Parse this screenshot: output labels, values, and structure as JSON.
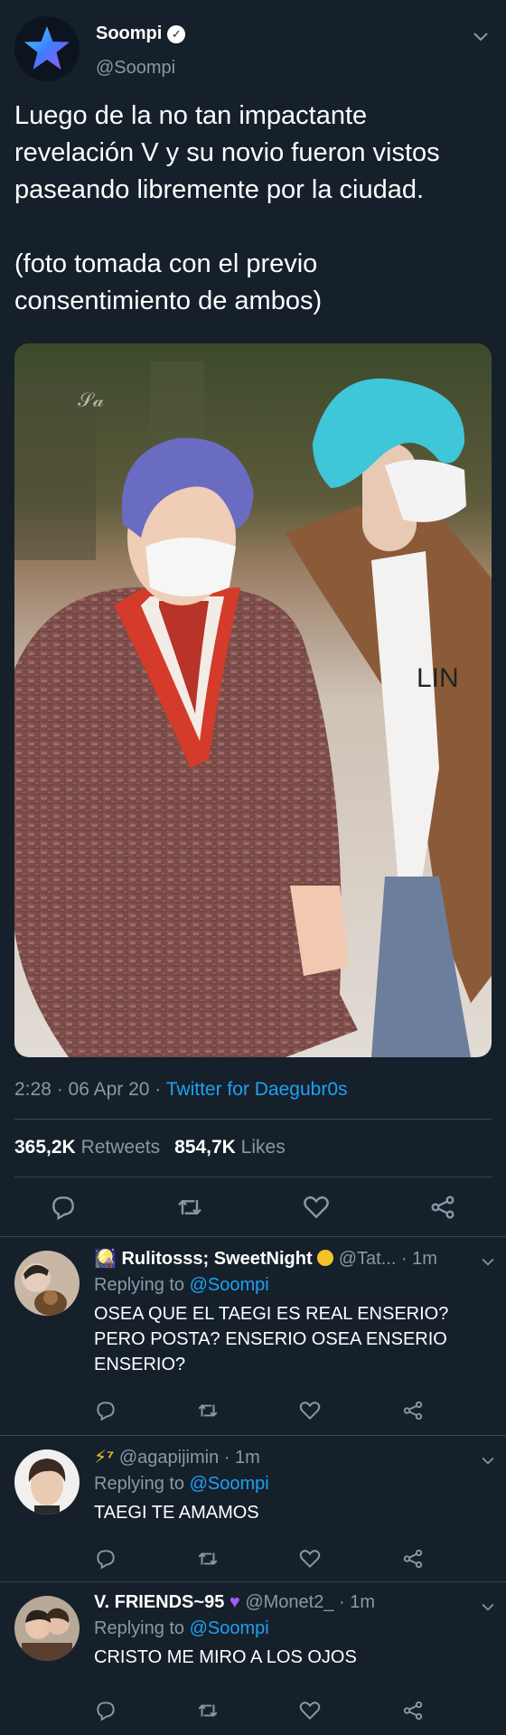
{
  "post": {
    "author_name": "Soompi",
    "handle": "@Soompi",
    "text_1": "Luego de la no tan impactante revelación V y su novio fueron vistos paseando libremente por la ciudad.",
    "text_2": "(foto tomada con el previo consentimiento de ambos)",
    "time": "2:28",
    "date": "06 Apr 20",
    "source": "Twitter for Daegubr0s",
    "retweets_count": "365,2K",
    "retweets_label": "Retweets",
    "likes_count": "854,7K",
    "likes_label": "Likes",
    "photo_shirt_text": "LIN"
  },
  "replies": [
    {
      "name": "Rulitosss; SweetNight",
      "handle": "@Tat...",
      "time": "1m",
      "replying_label": "Replying to",
      "mention": "@Soompi",
      "text": "OSEA QUE EL TAEGI ES REAL ENSERIO? PERO POSTA? ENSERIO OSEA ENSERIO ENSERIO?"
    },
    {
      "name": "⚡⁷",
      "handle": "@agapijimin",
      "time": "1m",
      "replying_label": "Replying to",
      "mention": "@Soompi",
      "text": "TAEGI TE AMAMOS"
    },
    {
      "name": "V. FRIENDS~95",
      "handle": "@Monet2_",
      "time": "1m",
      "replying_label": "Replying to",
      "mention": "@Soompi",
      "text": "CRISTO ME MIRO A LOS OJOS"
    }
  ],
  "colors": {
    "background": "#15202b",
    "secondary_text": "#8899a6",
    "link": "#1da1f2",
    "divider": "#38444d"
  },
  "icons": [
    "star-logo-icon",
    "verified-icon",
    "chevron-down-icon",
    "reply-icon",
    "retweet-icon",
    "like-icon",
    "share-icon",
    "purple-heart-icon",
    "yellow-circle-icon"
  ]
}
